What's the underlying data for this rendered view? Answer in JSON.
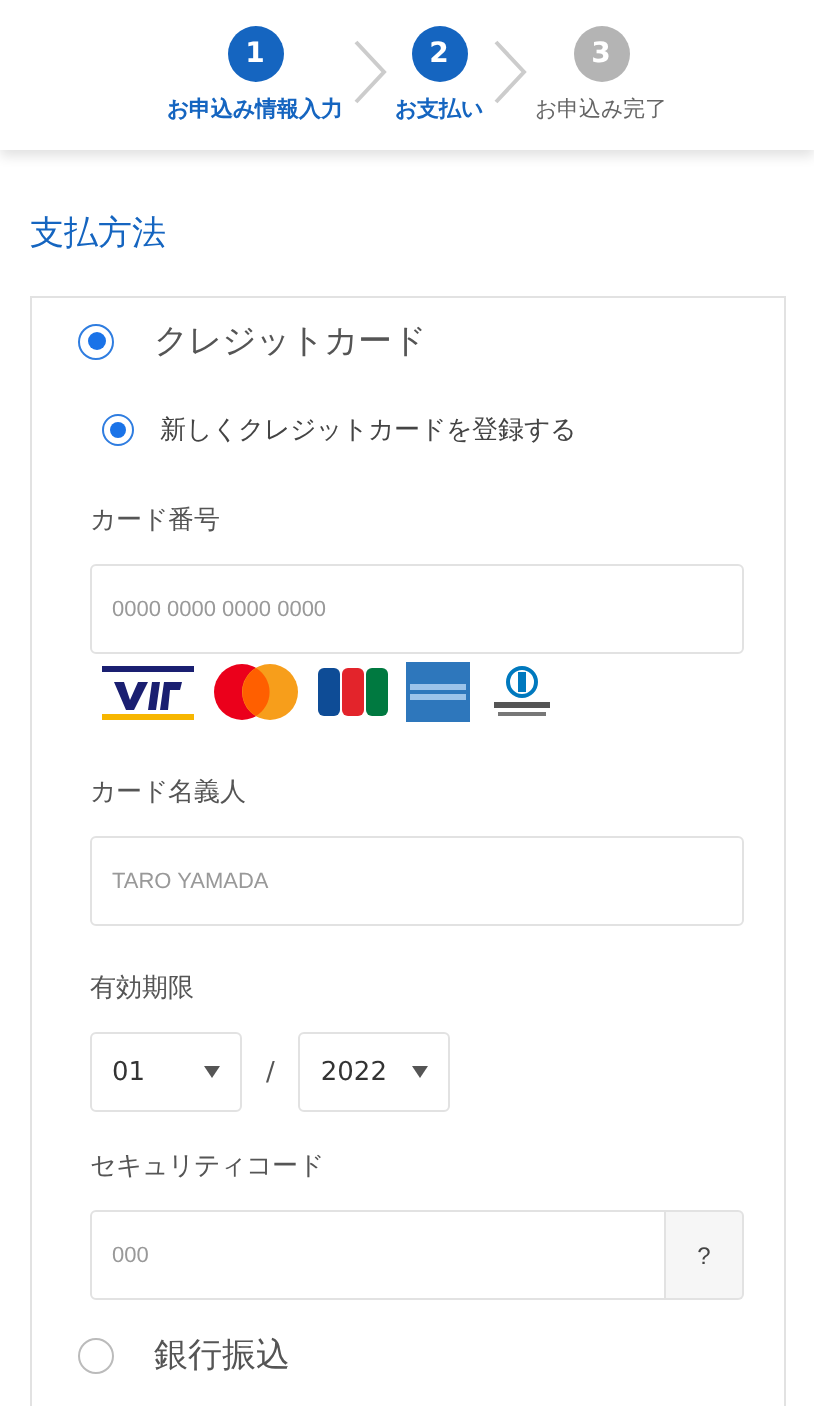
{
  "steps": [
    {
      "number": "1",
      "label": "お申込み情報入力",
      "active": true
    },
    {
      "number": "2",
      "label": "お支払い",
      "active": true
    },
    {
      "number": "3",
      "label": "お申込み完了",
      "active": false
    }
  ],
  "section_title": "支払方法",
  "payment_methods": [
    {
      "label": "クレジットカード",
      "selected": true,
      "form": {
        "options": [
          {
            "label": "新しくクレジットカードを登録する",
            "selected": true
          }
        ],
        "card_number": {
          "label": "カード番号",
          "placeholder": "0000 0000 0000 0000"
        },
        "card_brands": [
          {
            "kind": "visa"
          },
          {
            "kind": "mastercard"
          },
          {
            "kind": "jcb"
          },
          {
            "kind": "amex"
          },
          {
            "kind": "diners"
          }
        ],
        "holder": {
          "label": "カード名義人",
          "placeholder": "TARO YAMADA"
        },
        "expiry": {
          "label": "有効期限",
          "month": "01",
          "separator": "/",
          "year": "2022"
        },
        "security_code": {
          "label": "セキュリティコード",
          "placeholder": "000",
          "help": "?"
        }
      }
    },
    {
      "label": "銀行振込",
      "selected": false
    }
  ]
}
